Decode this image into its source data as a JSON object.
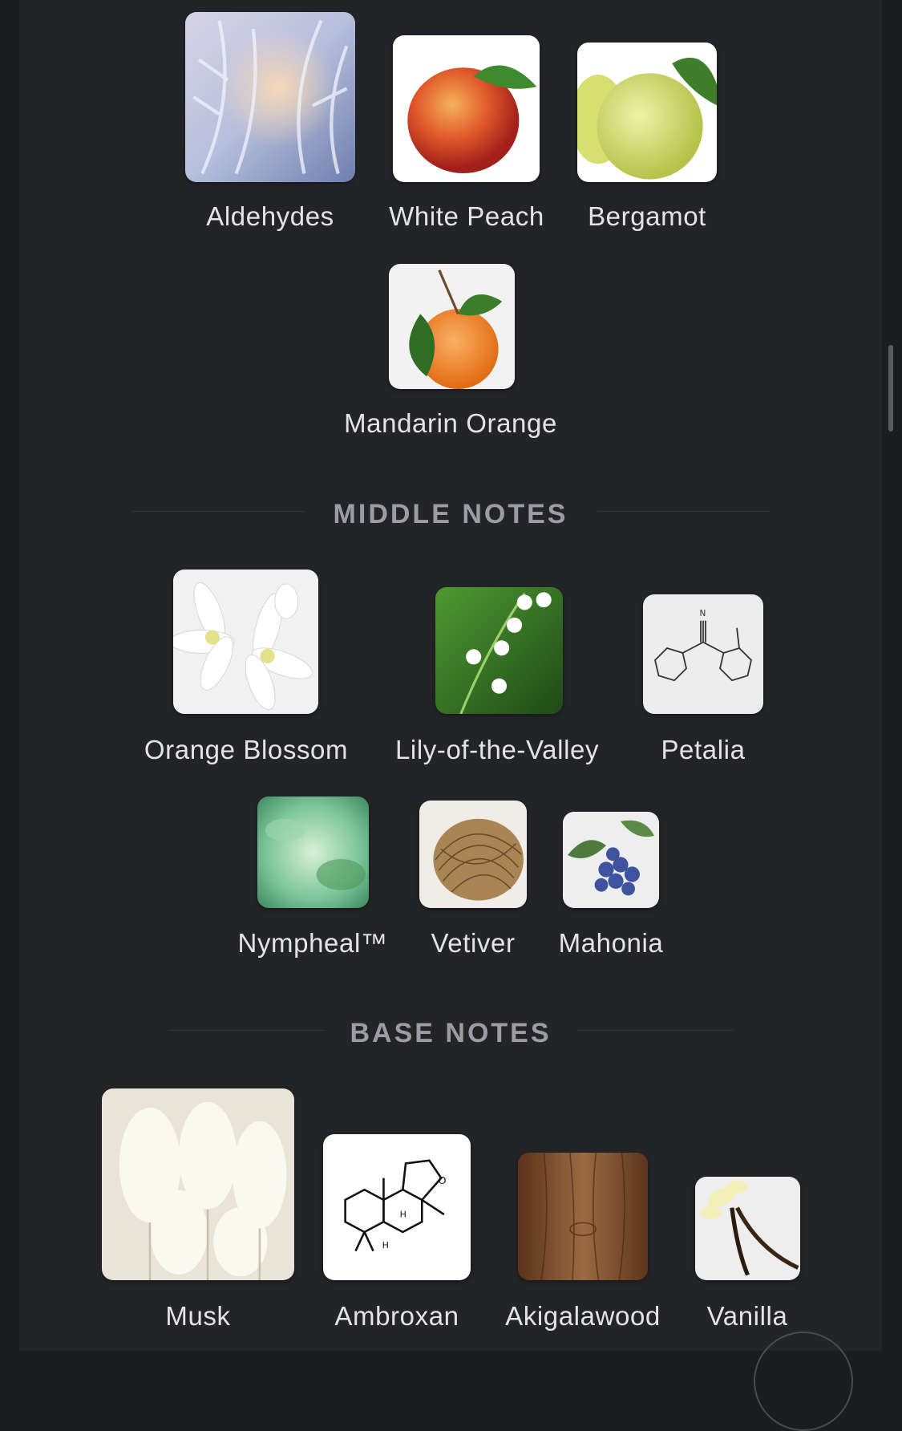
{
  "top_notes": {
    "items": [
      {
        "label": "Aldehydes",
        "icon": "frost-crystals-image"
      },
      {
        "label": "White Peach",
        "icon": "peach-image"
      },
      {
        "label": "Bergamot",
        "icon": "bergamot-image"
      },
      {
        "label": "Mandarin Orange",
        "icon": "mandarin-orange-image"
      }
    ]
  },
  "middle_notes": {
    "title": "MIDDLE NOTES",
    "items": [
      {
        "label": "Orange Blossom",
        "icon": "orange-blossom-image"
      },
      {
        "label": "Lily-of-the-Valley",
        "icon": "lily-of-the-valley-image"
      },
      {
        "label": "Petalia",
        "icon": "molecule-structure-image"
      },
      {
        "label": "Nympheal™",
        "icon": "green-leaves-image"
      },
      {
        "label": "Vetiver",
        "icon": "vetiver-roots-image"
      },
      {
        "label": "Mahonia",
        "icon": "mahonia-berries-image"
      }
    ]
  },
  "base_notes": {
    "title": "BASE NOTES",
    "items": [
      {
        "label": "Musk",
        "icon": "cotton-grass-image"
      },
      {
        "label": "Ambroxan",
        "icon": "molecule-structure-image"
      },
      {
        "label": "Akigalawood",
        "icon": "wood-grain-image"
      },
      {
        "label": "Vanilla",
        "icon": "vanilla-pod-image"
      }
    ]
  },
  "colors": {
    "background": "#1b1c20",
    "panel": "#232428",
    "label_text": "#e4e4e6",
    "section_title": "#9c9ca2"
  }
}
